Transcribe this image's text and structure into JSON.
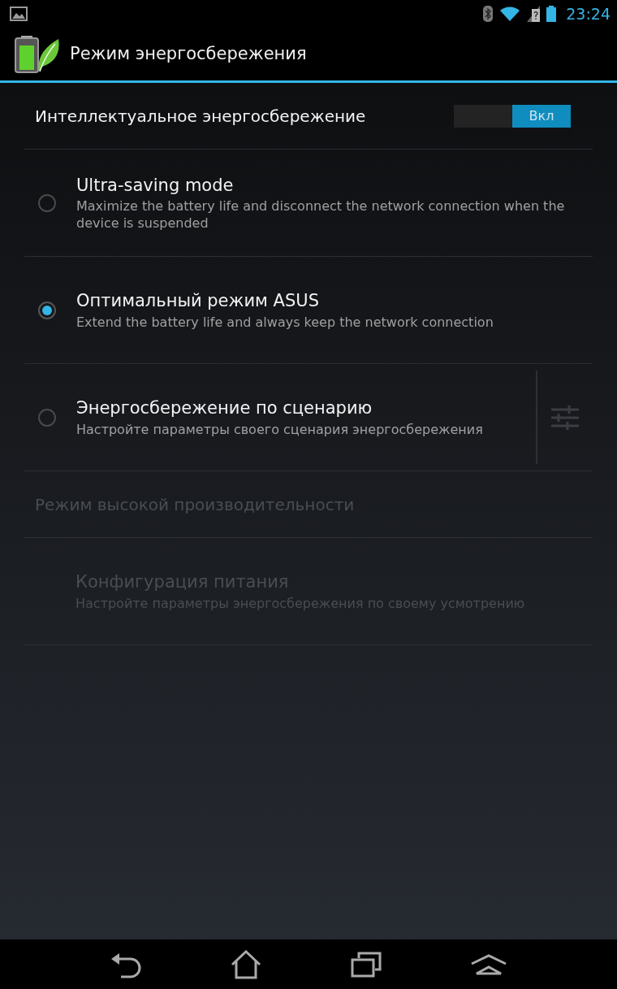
{
  "status_bar": {
    "time": "23:24"
  },
  "action_bar": {
    "title": "Режим энергосбережения"
  },
  "master_switch": {
    "label": "Интеллектуальное энергосбережение",
    "on": true,
    "state_label": "Вкл"
  },
  "modes": [
    {
      "title": "Ultra-saving mode",
      "summary": "Maximize the battery life and disconnect the network connection when the device is suspended",
      "selected": false,
      "has_settings": false
    },
    {
      "title": "Оптимальный режим ASUS",
      "summary": "Extend the battery life and always keep the network connection",
      "selected": true,
      "has_settings": false
    },
    {
      "title": "Энергосбережение по сценарию",
      "summary": "Настройте параметры своего сценария энергосбережения",
      "selected": false,
      "has_settings": true
    }
  ],
  "items": [
    {
      "kind": "header",
      "title": "Режим высокой производительности",
      "disabled": true
    },
    {
      "kind": "preference",
      "title": "Конфигурация питания",
      "summary": "Настройте параметры энергосбережения по своему усмотрению",
      "disabled": true
    }
  ]
}
